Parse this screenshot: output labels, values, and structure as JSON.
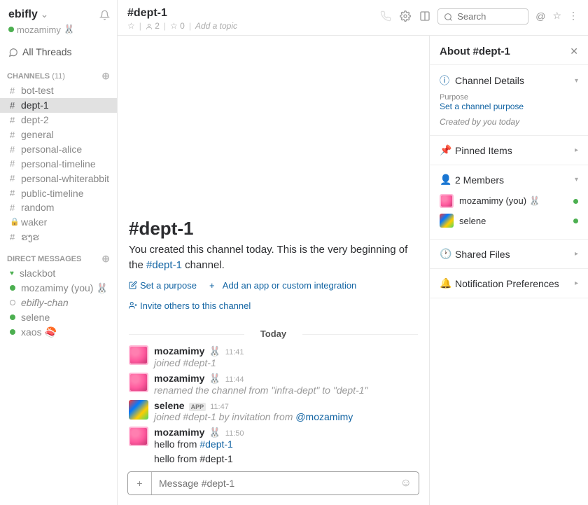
{
  "team": {
    "name": "ebifly",
    "user": "mozamimy",
    "user_emoji": "🐰"
  },
  "all_threads": "All Threads",
  "channels_header": "CHANNELS",
  "channels_count": "(11)",
  "channels": [
    {
      "name": "bot-test",
      "prefix": "#"
    },
    {
      "name": "dept-1",
      "prefix": "#",
      "active": true
    },
    {
      "name": "dept-2",
      "prefix": "#"
    },
    {
      "name": "general",
      "prefix": "#"
    },
    {
      "name": "personal-alice",
      "prefix": "#"
    },
    {
      "name": "personal-timeline",
      "prefix": "#"
    },
    {
      "name": "personal-whiterabbit",
      "prefix": "#"
    },
    {
      "name": "public-timeline",
      "prefix": "#"
    },
    {
      "name": "random",
      "prefix": "#"
    },
    {
      "name": "waker",
      "prefix": "lock"
    },
    {
      "name": "ຮງຮ",
      "prefix": "#"
    }
  ],
  "dm_header": "DIRECT MESSAGES",
  "dms": [
    {
      "name": "slackbot",
      "presence": "heart"
    },
    {
      "name": "mozamimy (you) 🐰",
      "presence": "active"
    },
    {
      "name": "ebifly-chan",
      "presence": "away",
      "italic": true
    },
    {
      "name": "selene",
      "presence": "active"
    },
    {
      "name": "xaos 🍣",
      "presence": "active"
    }
  ],
  "header": {
    "channel": "#dept-1",
    "star": "☆",
    "members": "2",
    "pins": "0",
    "add_topic": "Add a topic",
    "search_placeholder": "Search"
  },
  "intro": {
    "title": "#dept-1",
    "text_a": "You created this channel today. This is the very beginning of the ",
    "text_link": "#dept-1",
    "text_b": " channel.",
    "set_purpose": "Set a purpose",
    "add_app": "Add an app or custom integration",
    "invite": "Invite others to this channel"
  },
  "date_divider": "Today",
  "messages": [
    {
      "author": "mozamimy",
      "emoji": "🐰",
      "time": "11:41",
      "avatar": "pink",
      "system": true,
      "text": "joined #dept-1"
    },
    {
      "author": "mozamimy",
      "emoji": "🐰",
      "time": "11:44",
      "avatar": "pink",
      "system": true,
      "text": "renamed the channel from \"infra-dept\" to \"dept-1\""
    },
    {
      "author": "selene",
      "app": true,
      "time": "11:47",
      "avatar": "selene",
      "system": true,
      "text_parts": [
        "joined #dept-1 by invitation from ",
        "@mozamimy"
      ]
    },
    {
      "author": "mozamimy",
      "emoji": "🐰",
      "time": "11:50",
      "avatar": "pink",
      "text_parts": [
        "hello from ",
        "#dept-1"
      ],
      "extra_parts": [
        "hello from ",
        "#dept-1"
      ]
    }
  ],
  "composer_placeholder": "Message #dept-1",
  "about": {
    "title": "About #dept-1",
    "channel_details": "Channel Details",
    "purpose_label": "Purpose",
    "purpose_link": "Set a channel purpose",
    "created": "Created by you today",
    "pinned": "Pinned Items",
    "members_title": "2 Members",
    "members": [
      {
        "name": "mozamimy (you) 🐰",
        "avatar": "pink"
      },
      {
        "name": "selene",
        "avatar": "selene"
      }
    ],
    "shared_files": "Shared Files",
    "notification": "Notification Preferences"
  }
}
